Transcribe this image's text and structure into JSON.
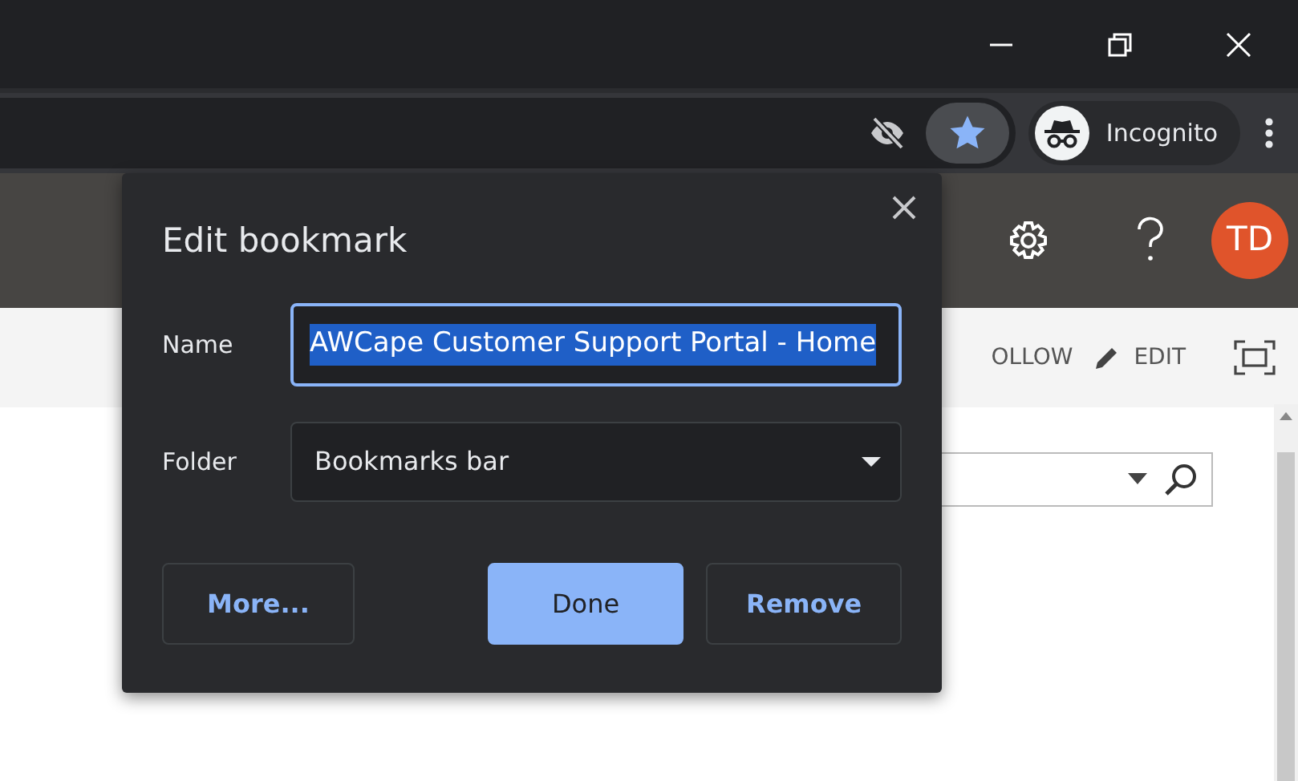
{
  "browser": {
    "toolbar": {
      "tracking_blocked": true,
      "bookmarked": true,
      "profile_label": "Incognito"
    }
  },
  "site_header": {
    "avatar_initials": "TD"
  },
  "site_subbar": {
    "follow_label": "OLLOW",
    "edit_label": "EDIT"
  },
  "dialog": {
    "title": "Edit bookmark",
    "name_label": "Name",
    "name_value": "AWCape Customer Support Portal - Home",
    "name_selected": true,
    "folder_label": "Folder",
    "folder_value": "Bookmarks bar",
    "buttons": [
      {
        "label": "More...",
        "kind": "secondary"
      },
      {
        "label": "Done",
        "kind": "primary"
      },
      {
        "label": "Remove",
        "kind": "secondary"
      }
    ]
  }
}
